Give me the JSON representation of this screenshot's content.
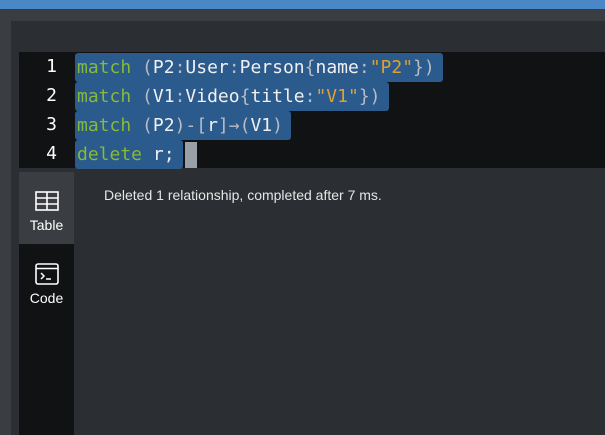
{
  "editor": {
    "line_numbers": [
      "1",
      "2",
      "3",
      "4"
    ],
    "lines": [
      [
        {
          "t": "match",
          "c": "kw"
        },
        {
          "t": " (",
          "c": "op"
        },
        {
          "t": "P2",
          "c": "ident"
        },
        {
          "t": ":",
          "c": "op"
        },
        {
          "t": "User",
          "c": "ident"
        },
        {
          "t": ":",
          "c": "op"
        },
        {
          "t": "Person",
          "c": "ident"
        },
        {
          "t": "{",
          "c": "op"
        },
        {
          "t": "name",
          "c": "ident"
        },
        {
          "t": ":",
          "c": "op"
        },
        {
          "t": "\"P2\"",
          "c": "str"
        },
        {
          "t": "})",
          "c": "op"
        }
      ],
      [
        {
          "t": "match",
          "c": "kw"
        },
        {
          "t": " (",
          "c": "op"
        },
        {
          "t": "V1",
          "c": "ident"
        },
        {
          "t": ":",
          "c": "op"
        },
        {
          "t": "Video",
          "c": "ident"
        },
        {
          "t": "{",
          "c": "op"
        },
        {
          "t": "title",
          "c": "ident"
        },
        {
          "t": ":",
          "c": "op"
        },
        {
          "t": "\"V1\"",
          "c": "str"
        },
        {
          "t": "})",
          "c": "op"
        }
      ],
      [
        {
          "t": "match",
          "c": "kw"
        },
        {
          "t": " (",
          "c": "op"
        },
        {
          "t": "P2",
          "c": "ident"
        },
        {
          "t": ")-[",
          "c": "op"
        },
        {
          "t": "r",
          "c": "ident"
        },
        {
          "t": "]→(",
          "c": "op"
        },
        {
          "t": "V1",
          "c": "ident"
        },
        {
          "t": ")",
          "c": "op"
        }
      ],
      [
        {
          "t": "delete",
          "c": "kw"
        },
        {
          "t": " ",
          "c": "op"
        },
        {
          "t": "r;",
          "c": "ident"
        }
      ]
    ]
  },
  "sidebar": {
    "table_label": "Table",
    "code_label": "Code"
  },
  "result": {
    "message": "Deleted 1 relationship, completed after 7 ms."
  },
  "colors": {
    "accent_bar": "#4a87c7",
    "selection": "#2b5a8c",
    "keyword": "#87b93a",
    "string": "#e0a030"
  }
}
